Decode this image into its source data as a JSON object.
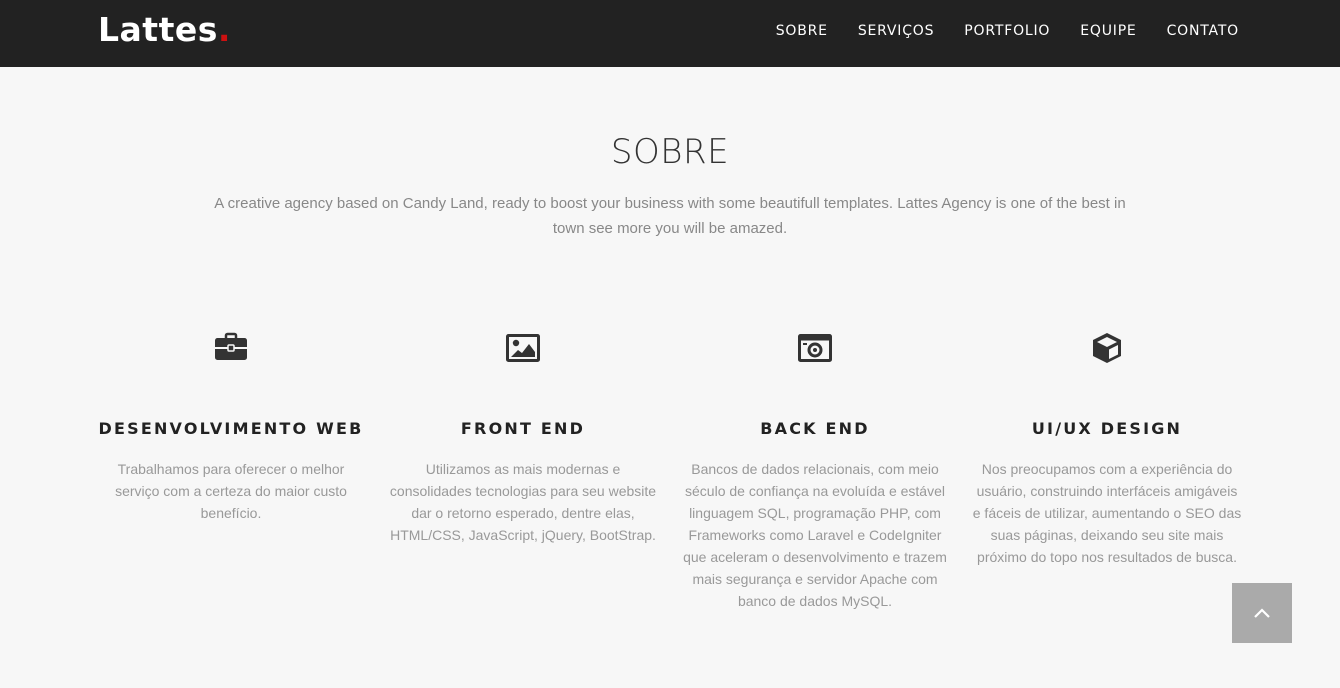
{
  "nav": {
    "brand": "Lattes",
    "brand_dot": ".",
    "brand_dot_color": "#cc1111",
    "links": [
      "SOBRE",
      "SERVIÇOS",
      "PORTFOLIO",
      "EQUIPE",
      "CONTATO"
    ]
  },
  "about": {
    "title": "SOBRE",
    "description": "A creative agency based on Candy Land, ready to boost your business with some beautifull templates. Lattes Agency is one of the best in town see more you will be amazed."
  },
  "features": [
    {
      "icon": "briefcase-icon",
      "title": "DESENVOLVIMENTO WEB",
      "text": "Trabalhamos para oferecer o melhor serviço com a certeza do maior custo benefício."
    },
    {
      "icon": "image-icon",
      "title": "FRONT END",
      "text": "Utilizamos as mais modernas e consolidades tecnologias para seu website dar o retorno esperado, dentre elas, HTML/CSS, JavaScript, jQuery, BootStrap."
    },
    {
      "icon": "camera-icon",
      "title": "BACK END",
      "text": "Bancos de dados relacionais, com meio século de confiança na evoluída e estável linguagem SQL, programação PHP, com Frameworks como Laravel e CodeIgniter que aceleram o desenvolvimento e trazem mais segurança e servidor Apache com banco de dados MySQL."
    },
    {
      "icon": "cube-icon",
      "title": "UI/UX DESIGN",
      "text": "Nos preocupamos com a experiência do usuário, construindo interfáceis amigáveis e fáceis de utilizar, aumentando o SEO das suas páginas, deixando seu site mais próximo do topo nos resultados de busca."
    }
  ],
  "back_to_top": {
    "icon": "chevron-up-icon"
  },
  "colors": {
    "navbar_bg": "#222222",
    "page_bg": "#f7f7f7",
    "accent": "#cc1111",
    "back_to_top_bg": "#aaaaaa"
  }
}
